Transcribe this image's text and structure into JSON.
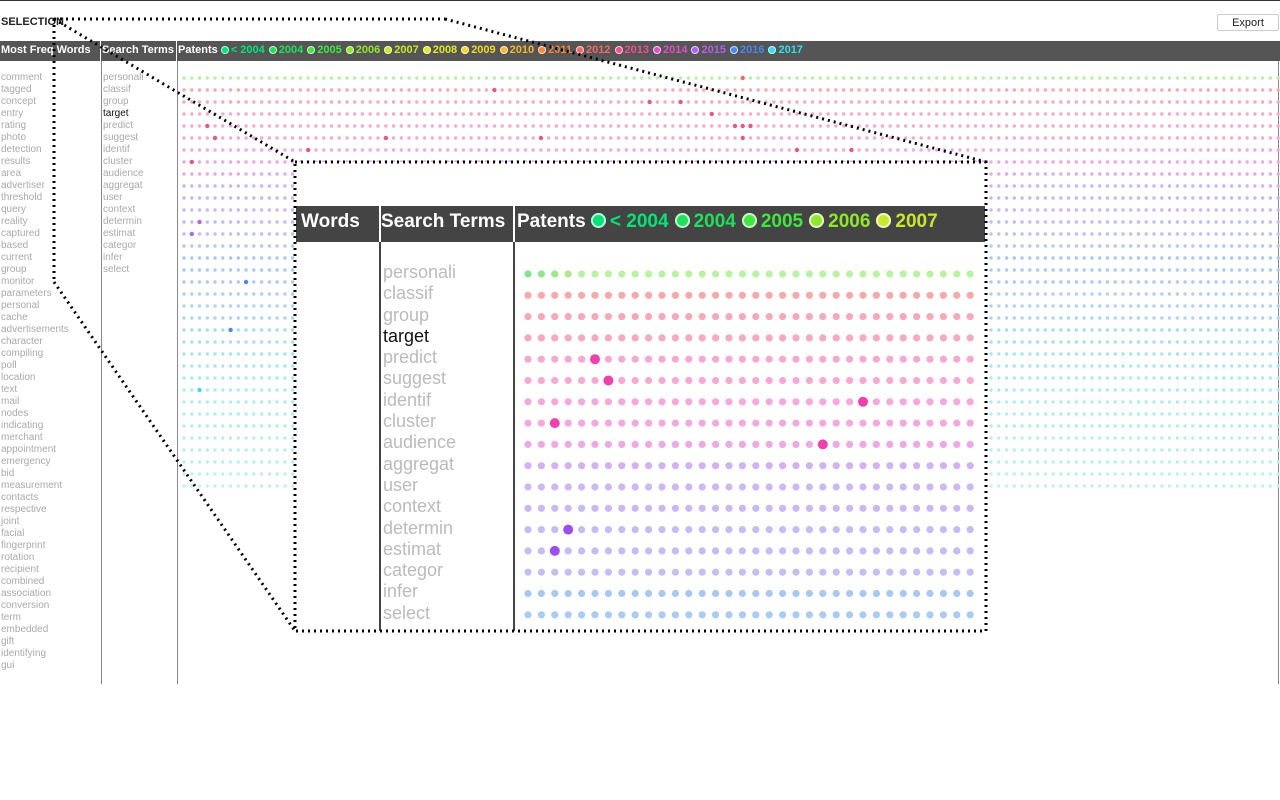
{
  "header": {
    "title": "SELECTION",
    "export_label": "Export"
  },
  "columns": {
    "words": "Most Freq Words",
    "terms": "Search Terms",
    "patents": "Patents"
  },
  "legend": [
    {
      "label": "< 2004",
      "color": "#00e676"
    },
    {
      "label": "2004",
      "color": "#1fe05a"
    },
    {
      "label": "2005",
      "color": "#3ee83e"
    },
    {
      "label": "2006",
      "color": "#8fe82a"
    },
    {
      "label": "2007",
      "color": "#c8e82a"
    },
    {
      "label": "2008",
      "color": "#e2e82a"
    },
    {
      "label": "2009",
      "color": "#f0d82a"
    },
    {
      "label": "2010",
      "color": "#f2b830"
    },
    {
      "label": "2011",
      "color": "#f48a40"
    },
    {
      "label": "2012",
      "color": "#f06a6a"
    },
    {
      "label": "2013",
      "color": "#f0508a"
    },
    {
      "label": "2014",
      "color": "#e050c8"
    },
    {
      "label": "2015",
      "color": "#b060ee"
    },
    {
      "label": "2016",
      "color": "#4a88f0"
    },
    {
      "label": "2017",
      "color": "#30e0f0"
    }
  ],
  "words": [
    "comment",
    "tagged",
    "concept",
    "entry",
    "rating",
    "photo",
    "detection",
    "results",
    "area",
    "advertiser",
    "threshold",
    "query",
    "reality",
    "captured",
    "based",
    "current",
    "group",
    "monitor",
    "parameters",
    "personal",
    "cache",
    "advertisements",
    "character",
    "compiling",
    "poll",
    "location",
    "text",
    "mail",
    "nodes",
    "indicating",
    "merchant",
    "appointment",
    "emergency",
    "bid",
    "measurement",
    "contacts",
    "respective",
    "joint",
    "facial",
    "fingerprint",
    "rotation",
    "recipient",
    "combined",
    "association",
    "conversion",
    "term",
    "embedded",
    "gift",
    "identifying",
    "gui"
  ],
  "search_terms": [
    "personali",
    "classif",
    "group",
    "target",
    "predict",
    "suggest",
    "identif",
    "cluster",
    "audience",
    "aggregat",
    "user",
    "context",
    "determin",
    "estimat",
    "categor",
    "infer",
    "select"
  ],
  "active_term": "target",
  "zoom": {
    "words_label": "Words",
    "terms_label": "Search Terms",
    "patents_label": "Patents",
    "legend": [
      {
        "label": "< 2004",
        "color": "#00e676"
      },
      {
        "label": "2004",
        "color": "#1fe05a"
      },
      {
        "label": "2005",
        "color": "#3ee83e"
      },
      {
        "label": "2006",
        "color": "#8fe82a"
      },
      {
        "label": "2007",
        "color": "#c8e82a"
      }
    ]
  },
  "matrix": {
    "row_colors": [
      "#b8f0a8",
      "#f8a8b0",
      "#f8a8c0",
      "#f8a8c8",
      "#f8a8d0",
      "#f4a8d8",
      "#f2a8e0",
      "#eaa8e8",
      "#e4a8ec",
      "#d4b0f4",
      "#ccb4f4",
      "#c8b8f4",
      "#c0bcf4",
      "#bcc0f4",
      "#b4c8f4",
      "#a8c8f4",
      "#a8ccf4",
      "#b0c8f4",
      "#b0d0f4",
      "#b0d4f4",
      "#a8d8f4",
      "#a8dcf4",
      "#a8e0f4",
      "#a8e4f4",
      "#a8e8f4",
      "#a8ecf4",
      "#a8eef4",
      "#b0eef4",
      "#b0f0f4",
      "#b0f0f0",
      "#b8f0f0",
      "#b8f0ec",
      "#b8f2ec",
      "#c0f2ec",
      "#c0f4ec"
    ],
    "highlights": [
      {
        "row": 0,
        "col": 72,
        "color": "#f06a6a"
      },
      {
        "row": 1,
        "col": 40,
        "color": "#f0508a"
      },
      {
        "row": 2,
        "col": 60,
        "color": "#f0508a"
      },
      {
        "row": 2,
        "col": 64,
        "color": "#f0508a"
      },
      {
        "row": 3,
        "col": 68,
        "color": "#f0508a"
      },
      {
        "row": 4,
        "col": 3,
        "color": "#f0508a"
      },
      {
        "row": 4,
        "col": 71,
        "color": "#f0508a"
      },
      {
        "row": 4,
        "col": 72,
        "color": "#f0508a"
      },
      {
        "row": 4,
        "col": 73,
        "color": "#f0508a"
      },
      {
        "row": 5,
        "col": 4,
        "color": "#f0508a"
      },
      {
        "row": 5,
        "col": 26,
        "color": "#f0508a"
      },
      {
        "row": 5,
        "col": 46,
        "color": "#f0508a"
      },
      {
        "row": 5,
        "col": 72,
        "color": "#f0508a"
      },
      {
        "row": 6,
        "col": 16,
        "color": "#f0508a"
      },
      {
        "row": 6,
        "col": 79,
        "color": "#f0508a"
      },
      {
        "row": 6,
        "col": 86,
        "color": "#f0508a"
      },
      {
        "row": 7,
        "col": 1,
        "color": "#f0508a"
      },
      {
        "row": 12,
        "col": 2,
        "color": "#b060ee"
      },
      {
        "row": 13,
        "col": 1,
        "color": "#b060ee"
      },
      {
        "row": 16,
        "col": 68,
        "color": "#4a88f0"
      },
      {
        "row": 16,
        "col": 70,
        "color": "#4a88f0"
      },
      {
        "row": 17,
        "col": 72,
        "color": "#4a88f0"
      },
      {
        "row": 16,
        "col": 73,
        "color": "#4a88f0"
      },
      {
        "row": 17,
        "col": 8,
        "color": "#4a88f0"
      },
      {
        "row": 19,
        "col": 81,
        "color": "#4a88f0"
      },
      {
        "row": 21,
        "col": 6,
        "color": "#4a88f0"
      },
      {
        "row": 21,
        "col": 77,
        "color": "#4a88f0"
      },
      {
        "row": 21,
        "col": 79,
        "color": "#4a88f0"
      },
      {
        "row": 23,
        "col": 82,
        "color": "#4a88f0"
      },
      {
        "row": 26,
        "col": 2,
        "color": "#30e0f0"
      }
    ]
  },
  "zoom_matrix": {
    "row_colors": [
      "#b8f4a0",
      "#f8a8a8",
      "#f8a8b8",
      "#f8a8c0",
      "#f8a8d0",
      "#f8a8d4",
      "#f6a8dc",
      "#f4a8e0",
      "#f0a8e4",
      "#d4b0f4",
      "#ccb8f4",
      "#c8b8f4",
      "#c4bcf4",
      "#c4bcf4",
      "#c0c0f4",
      "#a8c8f4",
      "#a8ccf4"
    ],
    "green_row0": [
      "#7ce88a",
      "#8ee88a",
      "#9ee88a",
      "#aee88a"
    ],
    "highlights": [
      {
        "row": 4,
        "col": 5,
        "color": "#f040b0"
      },
      {
        "row": 5,
        "col": 6,
        "color": "#f040b0"
      },
      {
        "row": 6,
        "col": 25,
        "color": "#f040b0"
      },
      {
        "row": 7,
        "col": 2,
        "color": "#f040b0"
      },
      {
        "row": 8,
        "col": 22,
        "color": "#f040b0"
      },
      {
        "row": 12,
        "col": 3,
        "color": "#9a4ef0"
      },
      {
        "row": 13,
        "col": 2,
        "color": "#9a4ef0"
      }
    ]
  }
}
